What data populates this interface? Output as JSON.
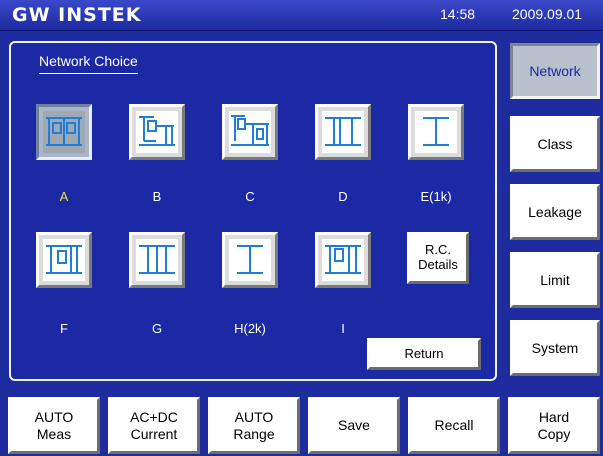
{
  "header": {
    "brand": "GW INSTEK",
    "time": "14:58",
    "date": "2009.09.01"
  },
  "panel": {
    "title": "Network Choice",
    "networks": [
      {
        "label": "A",
        "icon": "network-a-icon",
        "selected": true
      },
      {
        "label": "B",
        "icon": "network-b-icon",
        "selected": false
      },
      {
        "label": "C",
        "icon": "network-c-icon",
        "selected": false
      },
      {
        "label": "D",
        "icon": "network-d-icon",
        "selected": false
      },
      {
        "label": "E(1k)",
        "icon": "network-e-icon",
        "selected": false
      },
      {
        "label": "F",
        "icon": "network-f-icon",
        "selected": false
      },
      {
        "label": "G",
        "icon": "network-g-icon",
        "selected": false
      },
      {
        "label": "H(2k)",
        "icon": "network-h-icon",
        "selected": false
      },
      {
        "label": "I",
        "icon": "network-i-icon",
        "selected": false
      }
    ],
    "rc_details_label": "R.C.\nDetails",
    "return_label": "Return"
  },
  "side_menu": {
    "items": [
      {
        "label": "Network",
        "active": true
      },
      {
        "label": "Class",
        "active": false
      },
      {
        "label": "Leakage",
        "active": false
      },
      {
        "label": "Limit",
        "active": false
      },
      {
        "label": "System",
        "active": false
      }
    ]
  },
  "bottom_bar": {
    "buttons": [
      {
        "label": "AUTO\nMeas"
      },
      {
        "label": "AC+DC\nCurrent"
      },
      {
        "label": "AUTO\nRange"
      },
      {
        "label": "Save"
      },
      {
        "label": "Recall"
      },
      {
        "label": "Hard\nCopy"
      }
    ]
  },
  "colors": {
    "background": "#1e2ca0",
    "selected_label": "#f0e030",
    "circuit_line": "#1f7fd6"
  }
}
